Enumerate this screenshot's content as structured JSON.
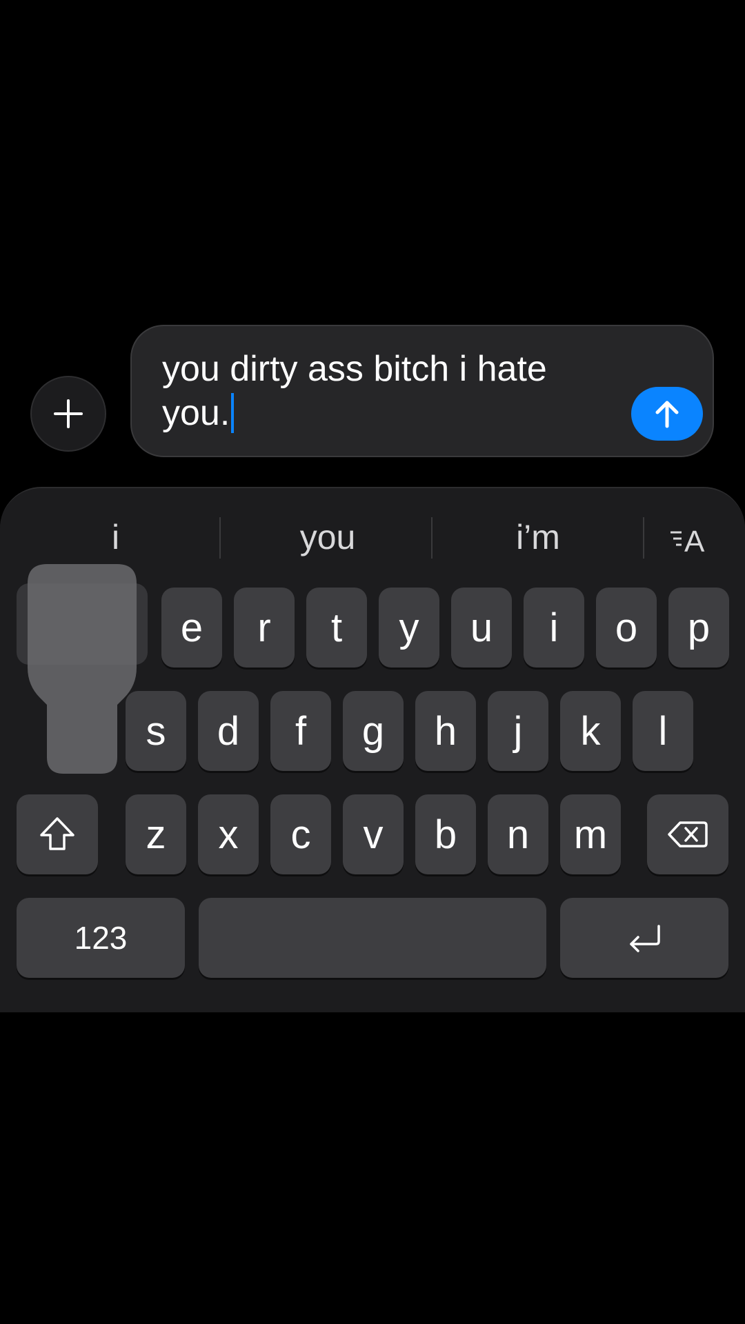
{
  "compose": {
    "message_text": "you dirty ass bitch i hate you.",
    "plus_icon": "plus-icon",
    "send_icon": "arrow-up-icon",
    "accent_color": "#0a84ff"
  },
  "keyboard": {
    "suggestions": [
      "i",
      "you",
      "i’m"
    ],
    "format_icon": "text-format-icon",
    "row1": [
      "e",
      "r",
      "t",
      "y",
      "u",
      "i",
      "o",
      "p"
    ],
    "row2": [
      "s",
      "d",
      "f",
      "g",
      "h",
      "j",
      "k",
      "l"
    ],
    "row3": [
      "z",
      "x",
      "c",
      "v",
      "b",
      "n",
      "m"
    ],
    "shift_icon": "shift-icon",
    "delete_icon": "delete-icon",
    "numbers_label": "123",
    "space_label": "",
    "return_icon": "return-icon"
  }
}
